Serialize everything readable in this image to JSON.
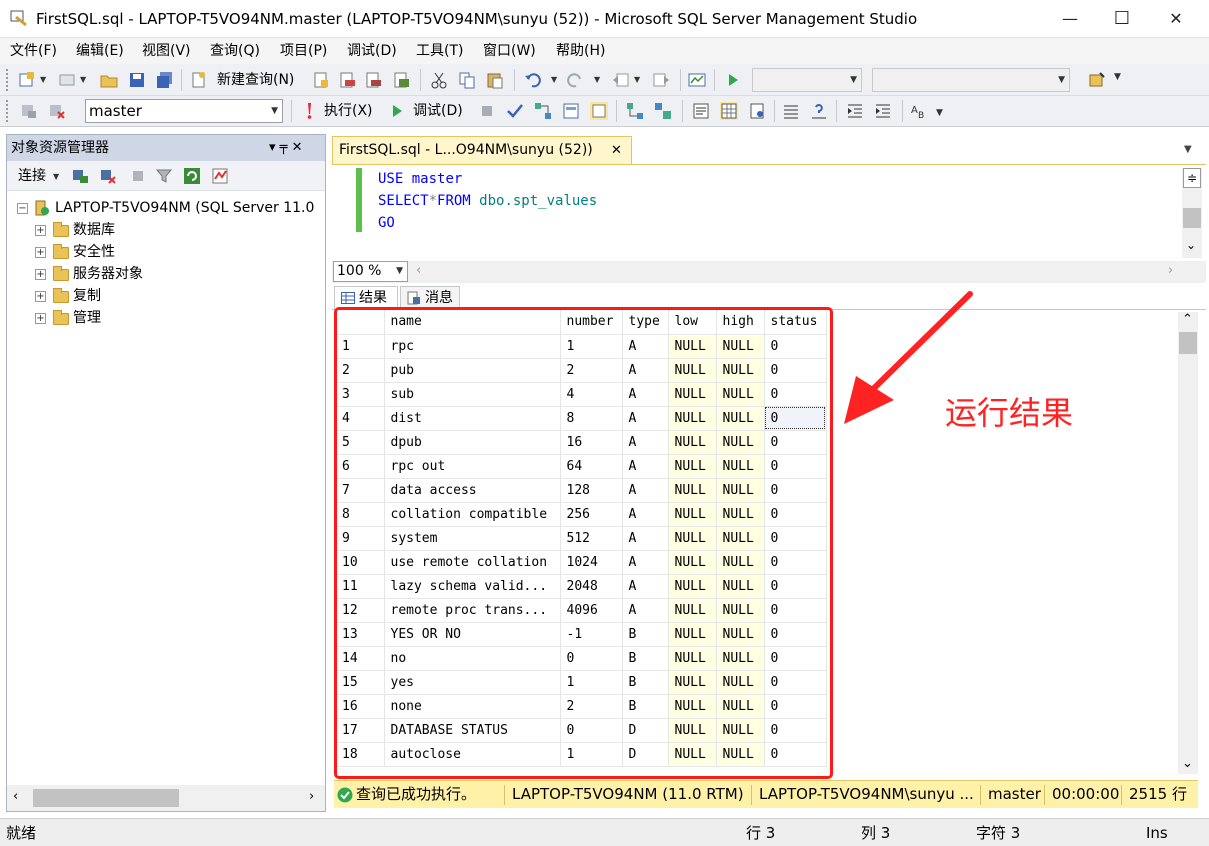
{
  "window": {
    "title": "FirstSQL.sql - LAPTOP-T5VO94NM.master (LAPTOP-T5VO94NM\\sunyu (52)) - Microsoft SQL Server Management Studio",
    "minimize": "—",
    "maximize": "☐",
    "close": "✕"
  },
  "menu": [
    "文件(F)",
    "编辑(E)",
    "视图(V)",
    "查询(Q)",
    "项目(P)",
    "调试(D)",
    "工具(T)",
    "窗口(W)",
    "帮助(H)"
  ],
  "toolbar": {
    "new_query": "新建查询(N)",
    "database": "master",
    "execute": "执行(X)",
    "debug": "调试(D)"
  },
  "object_explorer": {
    "title": "对象资源管理器",
    "pin": "▾ ╤ ✕",
    "connect": "连接",
    "server": "LAPTOP-T5VO94NM (SQL Server 11.0",
    "nodes": [
      "数据库",
      "安全性",
      "服务器对象",
      "复制",
      "管理"
    ]
  },
  "editor": {
    "tab_label": "FirstSQL.sql - L...O94NM\\sunyu (52))",
    "tab_close": "✕",
    "zoom": "100 %",
    "code": {
      "l1_kw": "USE",
      "l1_obj": " master",
      "l2_kw": "SELECT",
      "l2_op": "*",
      "l2_kw2": "FROM",
      "l2_obj": " dbo.spt_values",
      "l3_kw": "GO"
    }
  },
  "results": {
    "tab_results": "结果",
    "tab_messages": "消息",
    "columns": [
      "",
      "name",
      "number",
      "type",
      "low",
      "high",
      "status"
    ],
    "rows": [
      [
        "1",
        "rpc",
        "1",
        "A",
        "NULL",
        "NULL",
        "0"
      ],
      [
        "2",
        "pub",
        "2",
        "A",
        "NULL",
        "NULL",
        "0"
      ],
      [
        "3",
        "sub",
        "4",
        "A",
        "NULL",
        "NULL",
        "0"
      ],
      [
        "4",
        "dist",
        "8",
        "A",
        "NULL",
        "NULL",
        "0"
      ],
      [
        "5",
        "dpub",
        "16",
        "A",
        "NULL",
        "NULL",
        "0"
      ],
      [
        "6",
        "rpc out",
        "64",
        "A",
        "NULL",
        "NULL",
        "0"
      ],
      [
        "7",
        "data access",
        "128",
        "A",
        "NULL",
        "NULL",
        "0"
      ],
      [
        "8",
        "collation compatible",
        "256",
        "A",
        "NULL",
        "NULL",
        "0"
      ],
      [
        "9",
        "system",
        "512",
        "A",
        "NULL",
        "NULL",
        "0"
      ],
      [
        "10",
        "use remote collation",
        "1024",
        "A",
        "NULL",
        "NULL",
        "0"
      ],
      [
        "11",
        "lazy schema valid...",
        "2048",
        "A",
        "NULL",
        "NULL",
        "0"
      ],
      [
        "12",
        "remote proc trans...",
        "4096",
        "A",
        "NULL",
        "NULL",
        "0"
      ],
      [
        "13",
        "YES OR NO",
        "-1",
        "B",
        "NULL",
        "NULL",
        "0"
      ],
      [
        "14",
        "no",
        "0",
        "B",
        "NULL",
        "NULL",
        "0"
      ],
      [
        "15",
        "yes",
        "1",
        "B",
        "NULL",
        "NULL",
        "0"
      ],
      [
        "16",
        "none",
        "2",
        "B",
        "NULL",
        "NULL",
        "0"
      ],
      [
        "17",
        "DATABASE STATUS",
        "0",
        "D",
        "NULL",
        "NULL",
        "0"
      ],
      [
        "18",
        "autoclose",
        "1",
        "D",
        "NULL",
        "NULL",
        "0"
      ]
    ]
  },
  "query_status": {
    "message": "查询已成功执行。",
    "server": "LAPTOP-T5VO94NM (11.0 RTM)",
    "login": "LAPTOP-T5VO94NM\\sunyu ...",
    "database": "master",
    "elapsed": "00:00:00",
    "rows": "2515 行"
  },
  "statusbar": {
    "ready": "就绪",
    "line": "行 3",
    "col": "列 3",
    "char": "字符 3",
    "mode": "Ins"
  },
  "annotation": "运行结果",
  "colors": {
    "accent_red": "#ff1a1a",
    "status_yellow": "#fff1a8",
    "null_cell": "#ffffe1"
  }
}
